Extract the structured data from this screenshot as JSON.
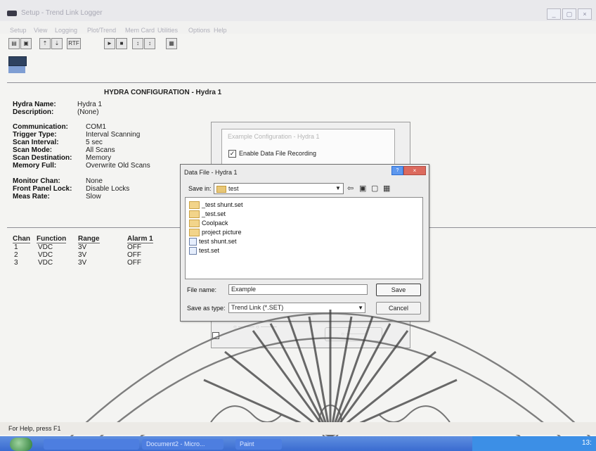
{
  "window": {
    "title": "Setup - Trend Link Logger",
    "menu": [
      "Setup",
      "View",
      "Logging",
      "Plot/Trend",
      "Mem Card",
      "Utilities",
      "Options",
      "Help"
    ],
    "toolbar_labels": [
      "RTF"
    ]
  },
  "config": {
    "title": "HYDRA CONFIGURATION - Hydra 1",
    "fields": [
      {
        "label": "Hydra Name:",
        "value": "Hydra 1"
      },
      {
        "label": "Description:",
        "value": "(None)"
      },
      {
        "label": "Communication:",
        "value": "COM1"
      },
      {
        "label": "Trigger Type:",
        "value": "Interval Scanning"
      },
      {
        "label": "Scan Interval:",
        "value": "5 sec"
      },
      {
        "label": "Scan Mode:",
        "value": "All Scans"
      },
      {
        "label": "Scan Destination:",
        "value": "Memory"
      },
      {
        "label": "Memory Full:",
        "value": "Overwrite Old Scans"
      },
      {
        "label": "Monitor Chan:",
        "value": "None"
      },
      {
        "label": "Front Panel Lock:",
        "value": "Disable Locks"
      },
      {
        "label": "Meas Rate:",
        "value": "Slow"
      }
    ]
  },
  "channels": {
    "headers": [
      "Chan",
      "Function",
      "Range",
      "Alarm 1"
    ],
    "rows": [
      [
        "1",
        "VDC",
        "3V",
        "OFF"
      ],
      [
        "2",
        "VDC",
        "3V",
        "OFF"
      ],
      [
        "3",
        "VDC",
        "3V",
        "OFF"
      ]
    ]
  },
  "status_bar": "For Help, press F1",
  "taskbar": {
    "tasks": [
      "Document2 - Micro...",
      "Paint"
    ],
    "time": "13:"
  },
  "background_dialog": {
    "title": "Example Configuration - Hydra 1",
    "enable_recording": "Enable Data File Recording"
  },
  "dialog": {
    "title": "Data File - Hydra 1",
    "save_in_label": "Save in:",
    "save_in_value": "test",
    "files": [
      {
        "name": "_test shunt.set",
        "type": "folder"
      },
      {
        "name": "_test.set",
        "type": "folder"
      },
      {
        "name": "Coolpack",
        "type": "folder"
      },
      {
        "name": "project picture",
        "type": "folder"
      },
      {
        "name": "test shunt.set",
        "type": "file"
      },
      {
        "name": "test.set",
        "type": "file"
      }
    ],
    "file_name_label": "File name:",
    "file_name_value": "Example",
    "save_as_type_label": "Save as type:",
    "save_as_type_value": "Trend Link (*.SET)",
    "save_button": "Save",
    "cancel_button": "Cancel"
  },
  "colors": {
    "taskbar": "#3a6bd0",
    "dialog_close": "#dc6a5e"
  }
}
